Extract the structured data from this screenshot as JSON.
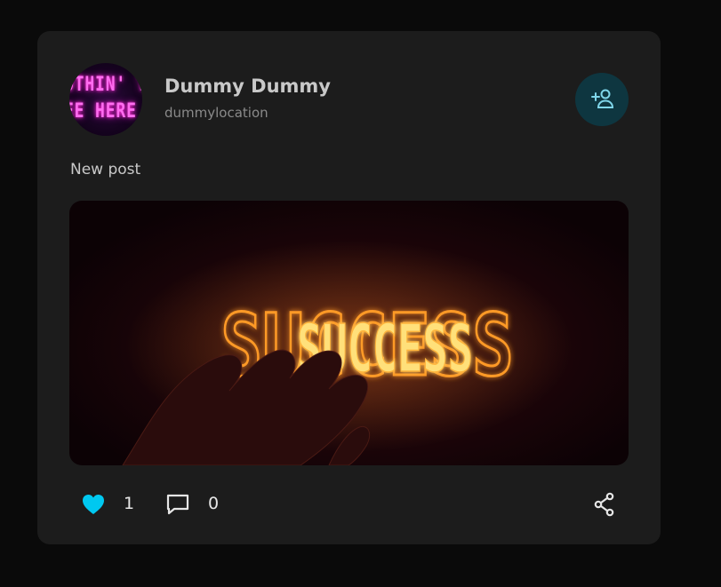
{
  "post": {
    "user": {
      "name": "Dummy Dummy",
      "location": "dummylocation",
      "avatar_text": [
        "OTHIN' T",
        "EE HERE"
      ]
    },
    "follow_icon": "add-user-icon",
    "text": "New post",
    "image": {
      "text": "SUCCESS"
    },
    "actions": {
      "likes": "1",
      "comments": "0",
      "like_icon": "heart-icon",
      "comment_icon": "comment-icon",
      "share_icon": "share-icon"
    }
  },
  "colors": {
    "page_bg": "#0a0a0a",
    "card_bg": "#1c1c1c",
    "accent": "#00c8f0",
    "follow_bg": "#0e3640",
    "neon_pink": "#ff6cf0",
    "neon_orange": "#ffb43a"
  }
}
